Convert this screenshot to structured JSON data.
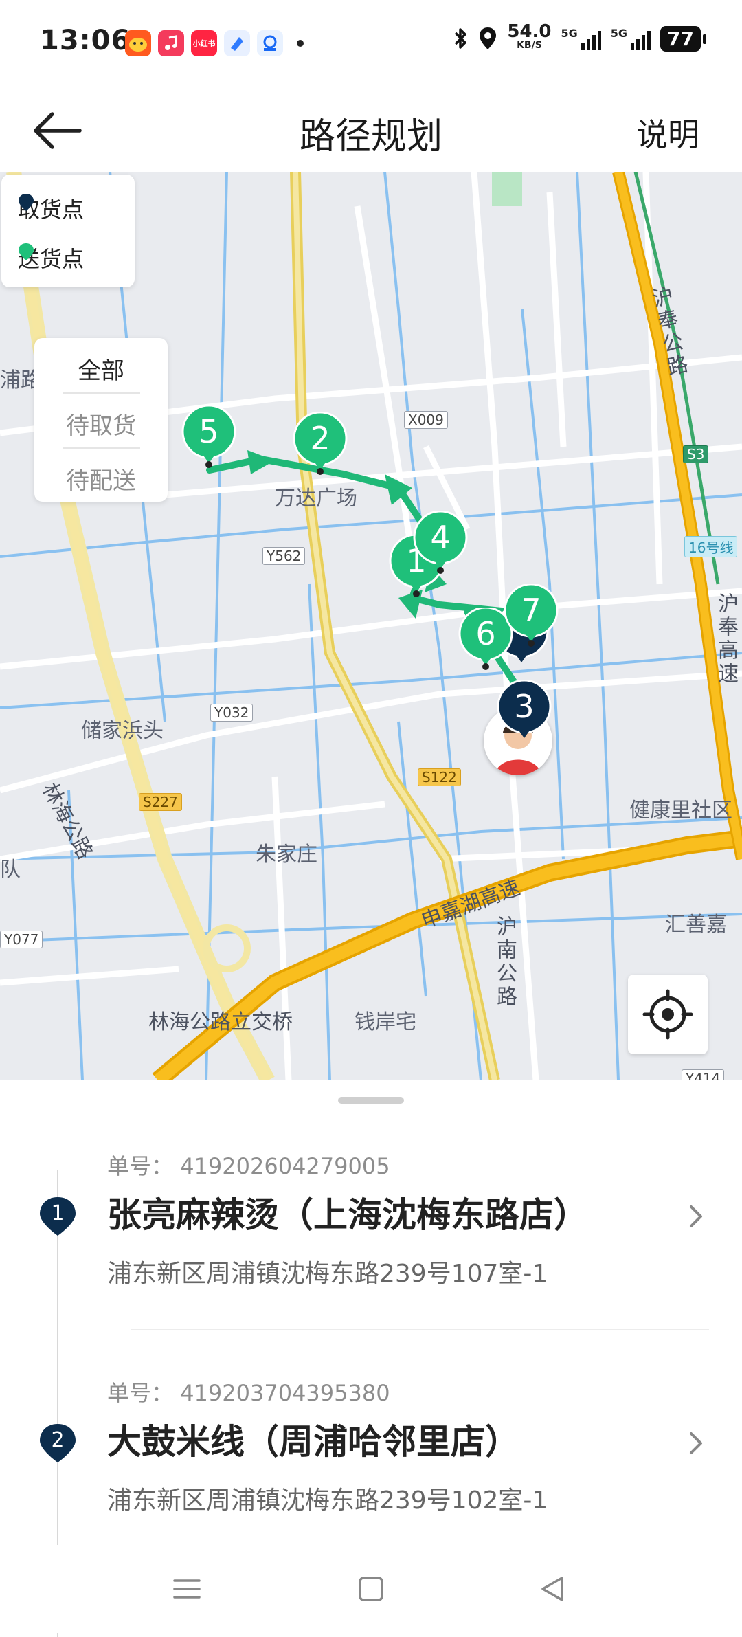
{
  "status_bar": {
    "time": "13:06",
    "speed_value": "54.0",
    "speed_unit": "KB/S",
    "net_a": "5G",
    "net_b": "5G",
    "battery": "77",
    "app_icons": [
      "taobao-icon",
      "music-icon",
      "xiaohongshu-icon",
      "blue-app-icon",
      "browser-icon"
    ],
    "app_icon_text": "小红书"
  },
  "header": {
    "title": "路径规划",
    "help_label": "说明"
  },
  "map": {
    "legend": {
      "pickup_label": "取货点",
      "delivery_label": "送货点",
      "pickup_color": "#0c2d4d",
      "delivery_color": "#1fc07a"
    },
    "filter": {
      "all": "全部",
      "to_pickup": "待取货",
      "to_deliver": "待配送"
    },
    "place_labels": {
      "wanda": "万达广场",
      "linhai_road": "林海公路",
      "chujiabang": "储家浜头",
      "zhujiazhuang": "朱家庄",
      "shenjiahu": "申嘉湖高速",
      "hunan_road": "沪南公路",
      "linhai_interchange": "林海公路立交桥",
      "qianan": "钱岸宅",
      "jiankangli": "健康里社区",
      "huishanjia": "汇善嘉",
      "hufeng_road": "沪奉公路",
      "hufeng_express": "沪奉高速",
      "pu_road": "浦路",
      "team": "队"
    },
    "road_badges": {
      "x009": "X009",
      "y562": "Y562",
      "y032": "Y032",
      "s122": "S122",
      "s227": "S227",
      "s3": "S3",
      "line16": "16号线",
      "y077": "Y077",
      "y414": "Y414"
    },
    "markers": {
      "m1": "1",
      "m2": "2",
      "m3": "3",
      "m4": "4",
      "m5": "5",
      "m6": "6",
      "m7": "7"
    }
  },
  "orders": [
    {
      "seq": "1",
      "number_label": "单号：",
      "number": "419202604279005",
      "name": "张亮麻辣烫（上海沈梅东路店）",
      "address": "浦东新区周浦镇沈梅东路239号107室-1"
    },
    {
      "seq": "2",
      "number_label": "单号：",
      "number": "419203704395380",
      "name": "大鼓米线（周浦哈邻里店）",
      "address": "浦东新区周浦镇沈梅东路239号102室-1"
    }
  ],
  "nav_bar": {
    "icons": [
      "menu-icon",
      "home-icon",
      "back-triangle-icon"
    ]
  }
}
